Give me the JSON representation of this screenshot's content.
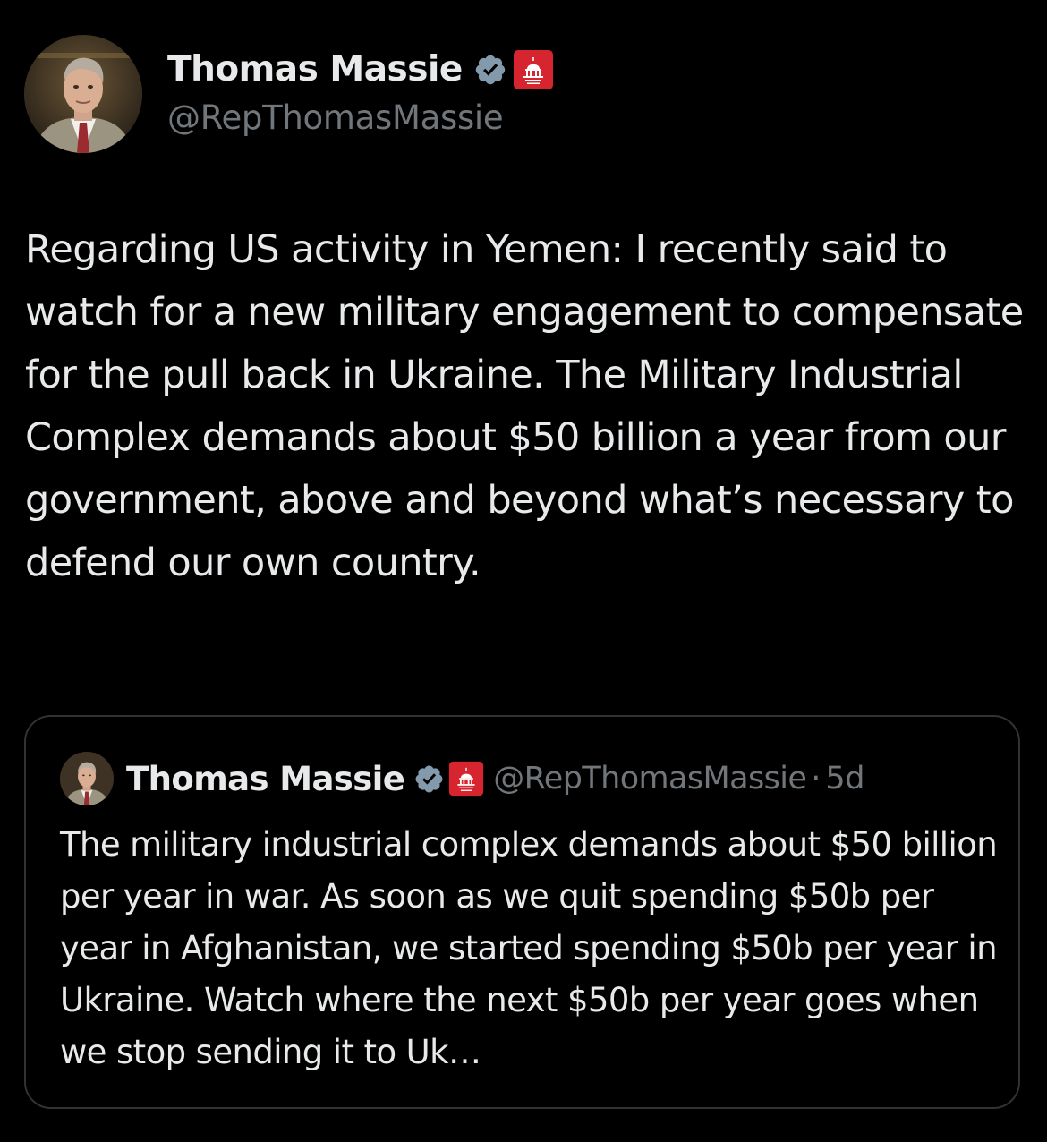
{
  "author": {
    "display_name": "Thomas Massie",
    "handle": "@RepThomasMassie",
    "avatar_icon": "avatar-photo",
    "verified_icon": "verified-badge-icon",
    "affiliation_icon": "house-gop-badge-icon"
  },
  "tweet": {
    "text": "Regarding US activity in Yemen: I recently said to watch for a new military engagement to compensate for the pull back in Ukraine. The Military Industrial Complex demands about $50 billion a year from our government, above and beyond what’s necessary to defend our own country."
  },
  "quote": {
    "display_name": "Thomas Massie",
    "handle": "@RepThomasMassie",
    "separator": "·",
    "timestamp": "5d",
    "text": "The military industrial complex demands about $50 billion per year in war. As soon as we quit spending $50b per year in Afghanistan, we started spending $50b per year in Ukraine. Watch where the next $50b per year goes when we stop sending it to Uk…"
  },
  "colors": {
    "background": "#000000",
    "primary_text": "#e7e9ea",
    "secondary_text": "#71767b",
    "verified_badge": "#829aab",
    "gop_badge": "#d7252f",
    "card_border": "#2f3336"
  }
}
